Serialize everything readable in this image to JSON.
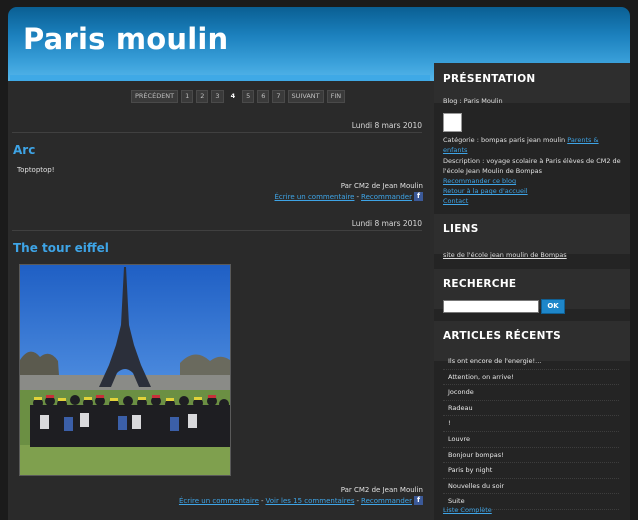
{
  "blog": {
    "title": "Paris moulin"
  },
  "pager": {
    "prev": "PRÉCÉDENT",
    "pages": [
      "1",
      "2",
      "3",
      "4",
      "5",
      "6",
      "7"
    ],
    "current": "4",
    "next": "SUIVANT",
    "last": "FIN"
  },
  "posts": [
    {
      "date": "Lundi 8 mars 2010",
      "title": "Arc",
      "text": "Toptoptop!",
      "byline": "Par CM2 de Jean Moulin",
      "comment": "Écrire un commentaire",
      "recommend": "Recommander"
    },
    {
      "date": "Lundi 8 mars 2010",
      "title": "The tour eiffel",
      "byline": "Par CM2 de Jean Moulin",
      "comment": "Écrire un commentaire",
      "view_comments": "Voir les 15 commentaires",
      "recommend": "Recommander"
    }
  ],
  "sidebar": {
    "presentation": {
      "heading": "PRÉSENTATION",
      "blog_line": "Blog : Paris Moulin",
      "category_label": "Catégorie : bompas paris jean moulin",
      "category_link": "Parents & enfants",
      "description": "Description : voyage scolaire à Paris élèves de CM2 de l'école Jean Moulin de Bompas",
      "links": [
        "Recommander ce blog",
        "Retour à la page d'accueil",
        "Contact"
      ]
    },
    "liens": {
      "heading": "LIENS",
      "items": [
        "site de l'école jean moulin de Bompas"
      ]
    },
    "recherche": {
      "heading": "RECHERCHE",
      "button": "OK"
    },
    "articles": {
      "heading": "ARTICLES RÉCENTS",
      "items": [
        "Ils ont encore de l'energie!...",
        "Attention, on arrive!",
        "Joconde",
        "Radeau",
        "!",
        "Louvre",
        "Bonjour bompas!",
        "Paris by night",
        "Nouvelles du soir",
        "Suite"
      ],
      "all_link": "Liste Complète"
    }
  },
  "colors": {
    "accent": "#3ea4e6",
    "banner": "#1b80bd",
    "background": "#2b2b2b"
  }
}
